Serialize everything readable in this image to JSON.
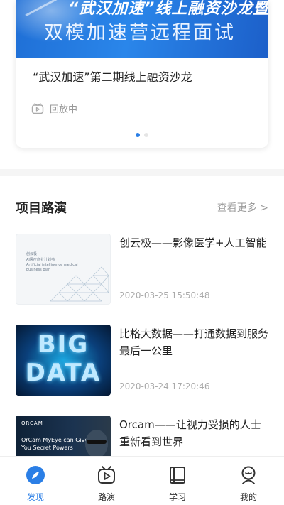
{
  "live_card": {
    "banner_line1": "“武汉加速”线上融资沙龙暨",
    "banner_line2": "双模加速营远程面试",
    "title": "“武汉加速”第二期线上融资沙龙",
    "status": "回放中",
    "carousel_count": 2,
    "carousel_active": 0
  },
  "section": {
    "title": "项目路演",
    "more": "查看更多 >"
  },
  "items": [
    {
      "title": "创云极——影像医学+人工智能",
      "date": "2020-03-25 15:50:48",
      "thumb_text": [
        "创云极",
        "AI医疗商业计划书",
        "Artificial intelligence medical",
        "business plan"
      ]
    },
    {
      "title": "比格大数据——打通数据到服务最后一公里",
      "date": "2020-03-24 17:20:46",
      "thumb_text": [
        "BIG",
        "DATA"
      ]
    },
    {
      "title": "Orcam——让视力受损的人士重新看到世界",
      "date": "",
      "thumb_text": [
        "ORCAM",
        "OrCam MyEye can Give",
        "You Secret Powers"
      ]
    }
  ],
  "nav": [
    {
      "label": "发现",
      "icon": "compass-icon",
      "active": true
    },
    {
      "label": "路演",
      "icon": "play-screen-icon",
      "active": false
    },
    {
      "label": "学习",
      "icon": "book-icon",
      "active": false
    },
    {
      "label": "我的",
      "icon": "user-icon",
      "active": false
    }
  ],
  "colors": {
    "accent": "#2b7fe6",
    "banner": "#1f6fd6",
    "muted_text": "#999999"
  }
}
